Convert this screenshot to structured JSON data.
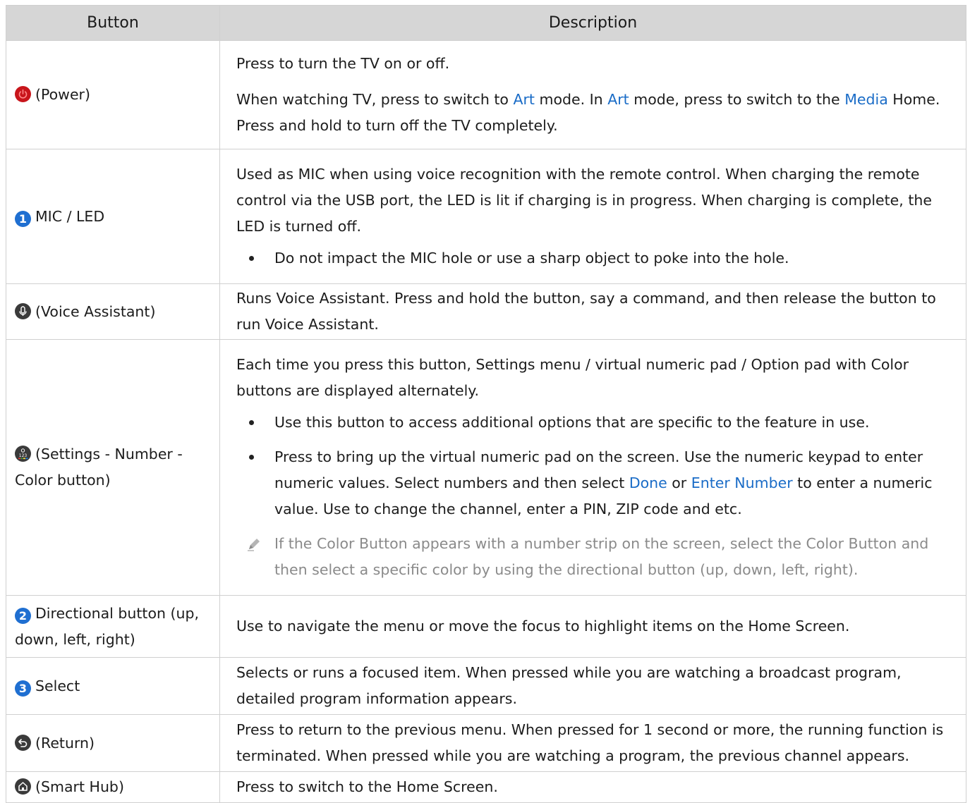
{
  "header": {
    "col1": "Button",
    "col2": "Description"
  },
  "rows": [
    {
      "button": "(Power)",
      "icon": "power-icon",
      "p1": "Press to turn the TV on or off.",
      "p2": {
        "a": "When watching TV, press to switch to ",
        "b": "Art",
        "c": " mode. In ",
        "d": "Art",
        "e": " mode, press to switch to the ",
        "f": "Media",
        "g": " Home. Press and hold to turn off the TV completely."
      }
    },
    {
      "num": "1",
      "button": "MIC / LED",
      "p1": "Used as MIC when using voice recognition with the remote control. When charging the remote control via the USB port, the LED is lit if charging is in progress. When charging is complete, the LED is turned off.",
      "bullet1": "Do not impact the MIC hole or use a sharp object to poke into the hole."
    },
    {
      "button": "(Voice Assistant)",
      "icon": "microphone-icon",
      "p1": "Runs Voice Assistant. Press and hold the button, say a command, and then release the button to run Voice Assistant."
    },
    {
      "button": "(Settings - Number - Color button)",
      "icon": "settings-number-color-icon",
      "p1": "Each time you press this button, Settings menu / virtual numeric pad / Option pad with Color buttons are displayed alternately.",
      "bullet1": "Use this button to access additional options that are specific to the feature in use.",
      "bullet2": {
        "a": "Press to bring up the virtual numeric pad on the screen. Use the numeric keypad to enter numeric values. Select numbers and then select ",
        "b": "Done",
        "c": " or ",
        "d": "Enter Number",
        "e": " to enter a numeric value. Use to change the channel, enter a PIN, ZIP code and etc."
      },
      "note": "If the Color Button appears with a number strip on the screen, select the Color Button and then select a specific color by using the directional button (up, down, left, right)."
    },
    {
      "num": "2",
      "button": "Directional button (up, down, left, right)",
      "p1": "Use to navigate the menu or move the focus to highlight items on the Home Screen."
    },
    {
      "num": "3",
      "button": "Select",
      "p1": "Selects or runs a focused item. When pressed while you are watching a broadcast program, detailed program information appears."
    },
    {
      "button": "(Return)",
      "icon": "return-icon",
      "p1": "Press to return to the previous menu. When pressed for 1 second or more, the running function is terminated. When pressed while you are watching a program, the previous channel appears."
    },
    {
      "button": "(Smart Hub)",
      "icon": "home-icon",
      "p1": "Press to switch to the Home Screen."
    }
  ],
  "colors": {
    "header_bg": "#d6d6d6",
    "link": "#1a6cc7",
    "number_badge": "#1f6fd1",
    "power": "#c8151b"
  }
}
